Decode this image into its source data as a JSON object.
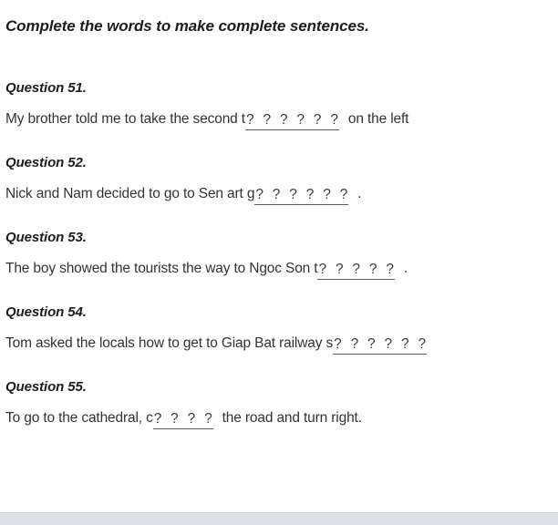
{
  "worksheet": {
    "title": "Complete the words to make complete sentences.",
    "blank_glyph": "?",
    "text_color": "#333333",
    "heading_color": "#1d1d1d",
    "blank_underline_color": "#5b5b63",
    "background_color": "#ffffff",
    "footer_band_color": "#dfe0e7",
    "questions": [
      {
        "label": "Question 51.",
        "prefix": "My brother told me to take the second t",
        "blank_count": 6,
        "suffix": "on the left"
      },
      {
        "label": "Question 52.",
        "prefix": "Nick and Nam decided to go to Sen art g",
        "blank_count": 6,
        "suffix": "."
      },
      {
        "label": "Question 53.",
        "prefix": "The boy showed the tourists the way to Ngoc Son t",
        "blank_count": 5,
        "suffix": "."
      },
      {
        "label": "Question 54.",
        "prefix": "Tom asked the locals how to get to Giap Bat railway s",
        "blank_count": 6,
        "suffix": ""
      },
      {
        "label": "Question 55.",
        "prefix": "To go to the cathedral, c",
        "blank_count": 4,
        "suffix": "the road and turn right."
      }
    ]
  }
}
